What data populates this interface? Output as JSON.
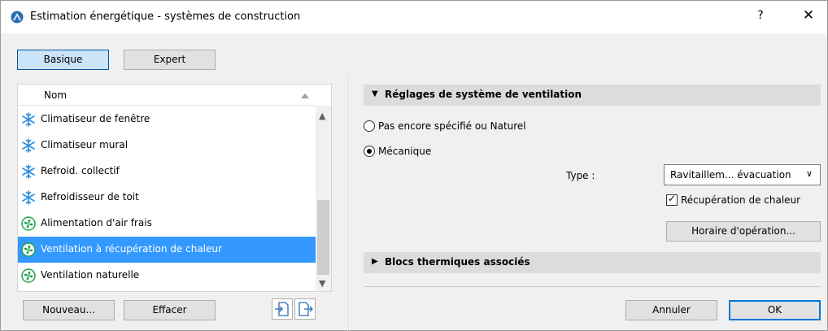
{
  "window": {
    "title": "Estimation énergétique - systèmes de construction",
    "help_label": "?",
    "close_label": "✕"
  },
  "mode_tabs": {
    "basic": "Basique",
    "expert": "Expert",
    "active": "Basique"
  },
  "list": {
    "column_header": "Nom",
    "items": [
      {
        "label": "Climatiseur de fenêtre",
        "icon": "snowflake-icon"
      },
      {
        "label": "Climatiseur mural",
        "icon": "snowflake-icon"
      },
      {
        "label": "Refroid. collectif",
        "icon": "snowflake-icon"
      },
      {
        "label": "Refroidisseur de toit",
        "icon": "snowflake-icon"
      },
      {
        "label": "Alimentation d'air frais",
        "icon": "fan-icon"
      },
      {
        "label": "Ventilation à récupération de chaleur",
        "icon": "fan-icon",
        "selected": true
      },
      {
        "label": "Ventilation naturelle",
        "icon": "fan-icon"
      }
    ]
  },
  "list_actions": {
    "new_label": "Nouveau...",
    "delete_label": "Effacer",
    "import_icon": "import-icon",
    "export_icon": "export-icon"
  },
  "ventilation": {
    "section_title": "Réglages de système de ventilation",
    "expanded": true,
    "option_natural": "Pas encore spécifié ou Naturel",
    "option_mechanical": "Mécanique",
    "selected_option": "Mécanique",
    "type_label": "Type :",
    "type_value": "Ravitaillem... évacuation",
    "heat_recovery_label": "Récupération de chaleur",
    "heat_recovery_checked": true,
    "schedule_button": "Horaire d'opération..."
  },
  "thermal_blocks": {
    "section_title": "Blocs thermiques associés",
    "expanded": false
  },
  "footer": {
    "cancel_label": "Annuler",
    "ok_label": "OK"
  },
  "colors": {
    "selection": "#3399ff",
    "snowflake": "#2b8fe0",
    "fan": "#1ea34a",
    "active_tab": "#cce4f7"
  }
}
